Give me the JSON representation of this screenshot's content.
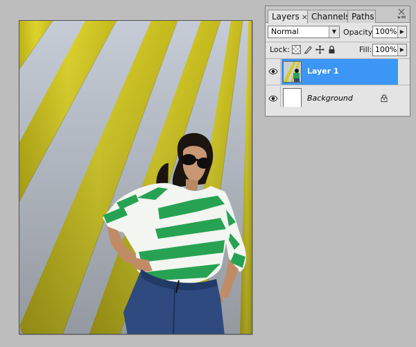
{
  "canvas": {
    "image_subject": "woman-striped-shirt-photo"
  },
  "panel": {
    "tabs": [
      {
        "label": "Layers",
        "active": true,
        "close": "×"
      },
      {
        "label": "Channels",
        "active": false
      },
      {
        "label": "Paths",
        "active": false
      }
    ],
    "menu_icon": "panel-menu-icon",
    "blend_mode": "Normal",
    "opacity_label": "Opacity:",
    "opacity_value": "100%",
    "lock_label": "Lock:",
    "fill_label": "Fill:",
    "fill_value": "100%",
    "layers": [
      {
        "name": "Layer 1",
        "selected": true,
        "visible": true,
        "locked": false
      },
      {
        "name": "Background",
        "selected": false,
        "visible": true,
        "locked": true
      }
    ]
  },
  "colors": {
    "selection": "#3d96f5",
    "stripe_yellow": "#d9cf2a",
    "stripe_white": "#c8ced6",
    "shirt_green": "#27a253",
    "jeans_blue": "#2e4a7e"
  }
}
